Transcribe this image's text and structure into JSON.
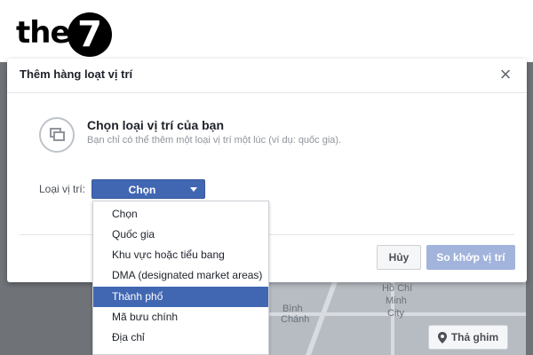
{
  "logo": {
    "text": "the",
    "numeral": "7"
  },
  "dialog": {
    "title": "Thêm hàng loạt vị trí",
    "close_label": "×",
    "section_title": "Chọn loại vị trí của bạn",
    "section_desc": "Bạn chỉ có thể thêm một loại vị trí một lúc (ví dụ: quốc gia).",
    "location_type_label": "Loại vị trí:",
    "select_value": "Chọn",
    "cancel_label": "Hủy",
    "match_label": "So khớp vị trí"
  },
  "dropdown": {
    "options": [
      "Chọn",
      "Quốc gia",
      "Khu vực hoặc tiểu bang",
      "DMA (designated market areas)",
      "Thành phố",
      "Mã bưu chính",
      "Địa chỉ"
    ],
    "highlighted_index": 4
  },
  "map": {
    "labels": [
      "Hồ Chí",
      "Minh",
      "City",
      "Bình",
      "Chánh"
    ],
    "pin_button_label": "Thả ghim"
  },
  "colors": {
    "primary": "#4267b2",
    "disabled_primary": "#a2b4dc",
    "backdrop": "#6f7277"
  }
}
